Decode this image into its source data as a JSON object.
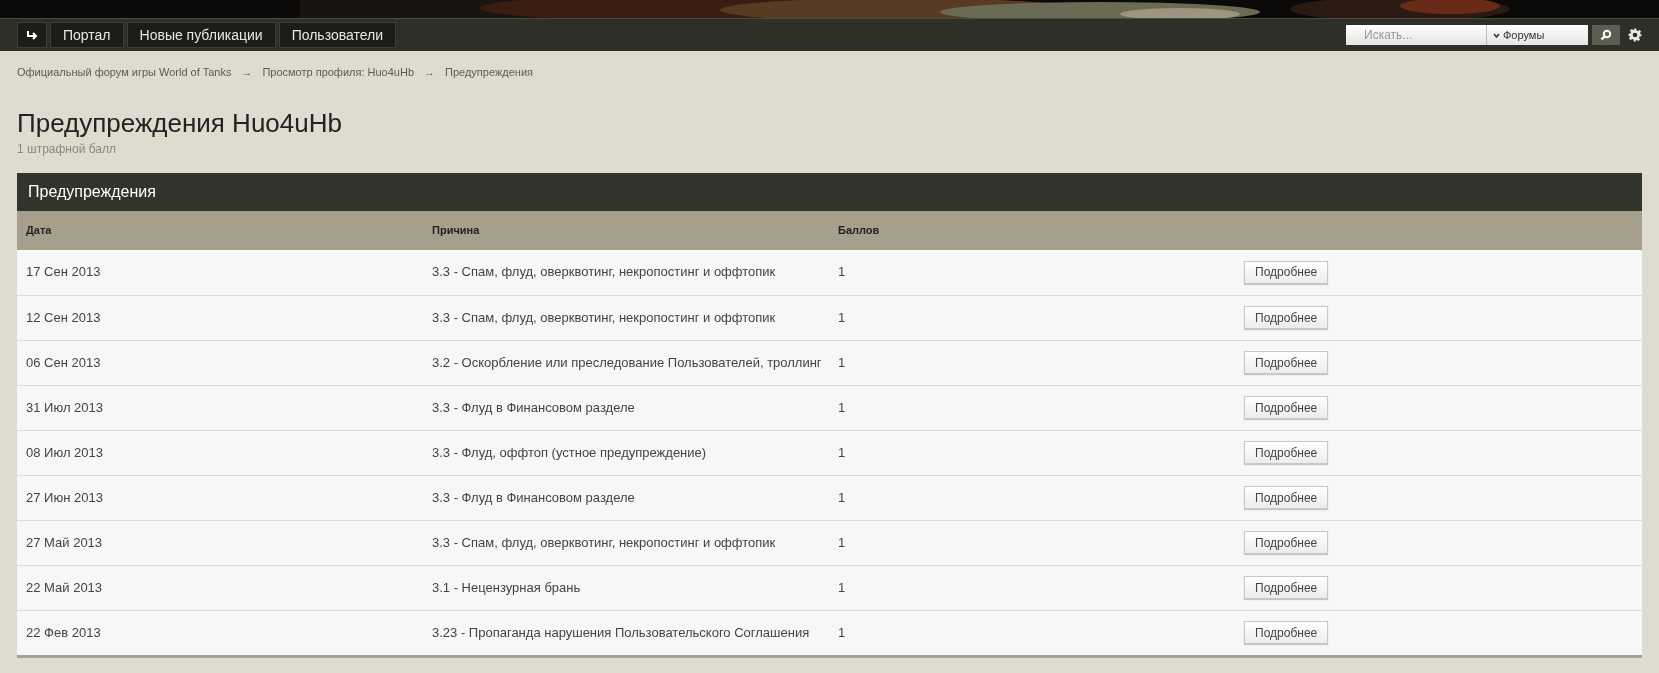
{
  "nav": {
    "items": [
      {
        "label": "Портал"
      },
      {
        "label": "Новые публикации"
      },
      {
        "label": "Пользователи"
      }
    ]
  },
  "search": {
    "placeholder": "Искать...",
    "scope": "Форумы"
  },
  "breadcrumbs": [
    "Официальный форум игры World of Tanks",
    "Просмотр профиля: Huo4uHb",
    "Предупреждения"
  ],
  "breadcrumb_separator": "→",
  "page": {
    "title": "Предупреждения Huo4uHb",
    "subtitle": "1 штрафной балл"
  },
  "table": {
    "title": "Предупреждения",
    "columns": [
      "Дата",
      "Причина",
      "Баллов"
    ],
    "rows": [
      {
        "date": "17 Сен 2013",
        "reason": "3.3 - Спам, флуд, оверквотинг, некропостинг и оффтопик",
        "points": "1",
        "action": "Подробнее"
      },
      {
        "date": "12 Сен 2013",
        "reason": "3.3 - Спам, флуд, оверквотинг, некропостинг и оффтопик",
        "points": "1",
        "action": "Подробнее"
      },
      {
        "date": "06 Сен 2013",
        "reason": "3.2 - Оскорбление или преследование Пользователей, троллинг",
        "points": "1",
        "action": "Подробнее"
      },
      {
        "date": "31 Июл 2013",
        "reason": "3.3 - Флуд в Финансовом разделе",
        "points": "1",
        "action": "Подробнее"
      },
      {
        "date": "08 Июл 2013",
        "reason": "3.3 - Флуд, оффтоп (устное предупреждение)",
        "points": "1",
        "action": "Подробнее"
      },
      {
        "date": "27 Июн 2013",
        "reason": "3.3 - Флуд в Финансовом разделе",
        "points": "1",
        "action": "Подробнее"
      },
      {
        "date": "27 Май 2013",
        "reason": "3.3 - Спам, флуд, оверквотинг, некропостинг и оффтопик",
        "points": "1",
        "action": "Подробнее"
      },
      {
        "date": "22 Май 2013",
        "reason": "3.1 - Нецензурная брань",
        "points": "1",
        "action": "Подробнее"
      },
      {
        "date": "22 Фев 2013",
        "reason": "3.23 - Пропаганда нарушения Пользовательского Соглашения",
        "points": "1",
        "action": "Подробнее"
      }
    ]
  }
}
